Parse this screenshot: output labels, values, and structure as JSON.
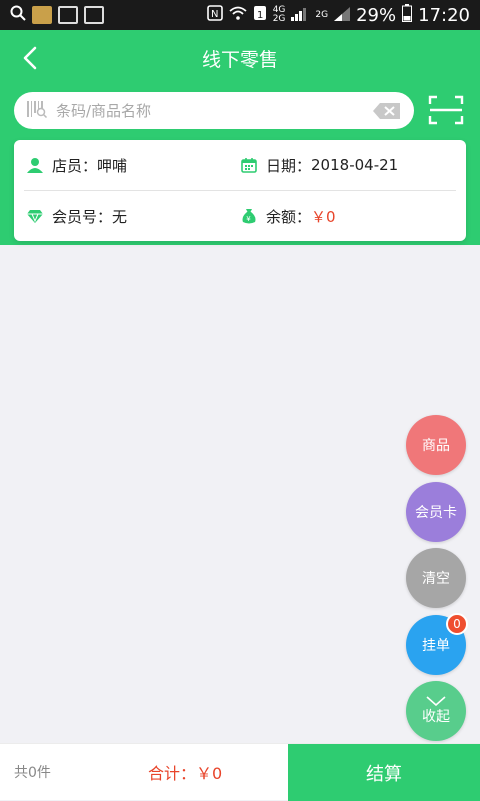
{
  "status_bar": {
    "battery": "29%",
    "time": "17:20",
    "net_labels": [
      "4G",
      "2G",
      "2G"
    ]
  },
  "header": {
    "title": "线下零售"
  },
  "search": {
    "placeholder": "条码/商品名称"
  },
  "info": {
    "clerk_label": "店员：",
    "clerk_value": "呷哺",
    "date_label": "日期：",
    "date_value": "2018-04-21",
    "member_label": "会员号：",
    "member_value": "无",
    "balance_label": "余额：",
    "balance_value": "￥0"
  },
  "fabs": {
    "goods": "商品",
    "member_card": "会员卡",
    "clear": "清空",
    "hold": "挂单",
    "hold_count": "0",
    "collapse": "收起"
  },
  "footer": {
    "count": "共0件",
    "total_label": "合计：",
    "total_value": "￥0",
    "checkout": "结算"
  },
  "colors": {
    "primary": "#2ecc71",
    "accent_red": "#e8442a",
    "fab_goods": "#f07779",
    "fab_member": "#9b7edb",
    "fab_clear": "#a6a6a6",
    "fab_hold": "#2aa3f0",
    "fab_collapse": "#58cd8c"
  },
  "icons": [
    "back-arrow-icon",
    "barcode-search-icon",
    "clear-icon",
    "scan-icon",
    "person-icon",
    "calendar-icon",
    "diamond-icon",
    "money-bag-icon",
    "chevron-down-icon"
  ]
}
